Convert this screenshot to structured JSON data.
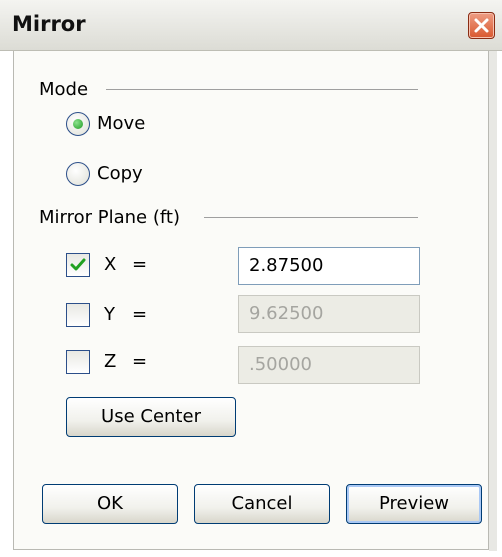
{
  "window": {
    "title": "Mirror"
  },
  "mode": {
    "label": "Mode",
    "options": [
      {
        "label": "Move",
        "selected": true
      },
      {
        "label": "Copy",
        "selected": false
      }
    ]
  },
  "plane": {
    "label": "Mirror Plane (ft)",
    "axes": [
      {
        "name": "X",
        "eq": "=",
        "checked": true,
        "value": "2.87500",
        "enabled": true
      },
      {
        "name": "Y",
        "eq": "=",
        "checked": false,
        "value": "9.62500",
        "enabled": false
      },
      {
        "name": "Z",
        "eq": "=",
        "checked": false,
        "value": ".50000",
        "enabled": false
      }
    ]
  },
  "buttons": {
    "use_center": "Use Center",
    "ok": "OK",
    "cancel": "Cancel",
    "preview": "Preview"
  },
  "icons": {
    "close": "close-icon",
    "checkmark": "checkmark-icon",
    "radio_dot": "radio-dot-icon"
  },
  "colors": {
    "close_button": "#d9582f",
    "radio_selected": "#1e9b22",
    "checkmark": "#21a121",
    "field_border": "#7f9db9",
    "disabled_field": "#ecece5"
  }
}
